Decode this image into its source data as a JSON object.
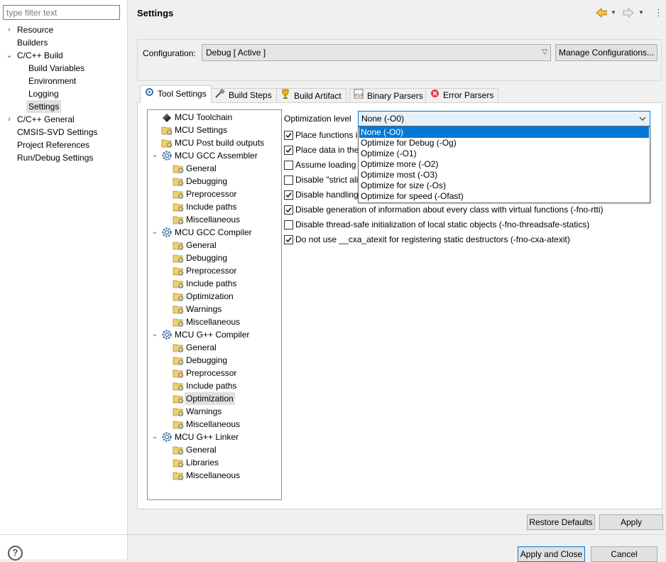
{
  "filter": {
    "placeholder": "type filter text"
  },
  "left_nav": [
    {
      "label": "Resource",
      "expandable": true
    },
    {
      "label": "Builders"
    },
    {
      "label": "C/C++ Build",
      "expanded": true
    },
    {
      "label": "Build Variables"
    },
    {
      "label": "Environment"
    },
    {
      "label": "Logging"
    },
    {
      "label": "Settings",
      "selected": true
    },
    {
      "label": "C/C++ General",
      "expandable": true
    },
    {
      "label": "CMSIS-SVD Settings"
    },
    {
      "label": "Project References"
    },
    {
      "label": "Run/Debug Settings"
    }
  ],
  "header": {
    "title": "Settings"
  },
  "config": {
    "label": "Configuration:",
    "value": "Debug  [ Active ]",
    "manage_label": "Manage Configurations..."
  },
  "tabs": [
    {
      "label": "Tool Settings",
      "icon": "tool-settings-icon",
      "active": true
    },
    {
      "label": "Build Steps",
      "icon": "build-steps-icon"
    },
    {
      "label": "Build Artifact",
      "icon": "build-artifact-icon"
    },
    {
      "label": "Binary Parsers",
      "icon": "binary-parsers-icon"
    },
    {
      "label": "Error Parsers",
      "icon": "error-parsers-icon"
    }
  ],
  "tree": [
    {
      "label": "MCU Toolchain",
      "level": 0,
      "icon": "toolchain-icon"
    },
    {
      "label": "MCU Settings",
      "level": 0,
      "icon": "folder-settings-icon"
    },
    {
      "label": "MCU Post build outputs",
      "level": 0,
      "icon": "folder-settings-icon"
    },
    {
      "label": "MCU GCC Assembler",
      "level": 0,
      "icon": "gear-icon",
      "expanded": true
    },
    {
      "label": "General",
      "level": 1,
      "icon": "folder-settings-icon"
    },
    {
      "label": "Debugging",
      "level": 1,
      "icon": "folder-settings-icon"
    },
    {
      "label": "Preprocessor",
      "level": 1,
      "icon": "folder-settings-icon"
    },
    {
      "label": "Include paths",
      "level": 1,
      "icon": "folder-settings-icon"
    },
    {
      "label": "Miscellaneous",
      "level": 1,
      "icon": "folder-settings-icon"
    },
    {
      "label": "MCU GCC Compiler",
      "level": 0,
      "icon": "gear-icon",
      "expanded": true
    },
    {
      "label": "General",
      "level": 1,
      "icon": "folder-settings-icon"
    },
    {
      "label": "Debugging",
      "level": 1,
      "icon": "folder-settings-icon"
    },
    {
      "label": "Preprocessor",
      "level": 1,
      "icon": "folder-settings-icon"
    },
    {
      "label": "Include paths",
      "level": 1,
      "icon": "folder-settings-icon"
    },
    {
      "label": "Optimization",
      "level": 1,
      "icon": "folder-settings-icon"
    },
    {
      "label": "Warnings",
      "level": 1,
      "icon": "folder-settings-icon"
    },
    {
      "label": "Miscellaneous",
      "level": 1,
      "icon": "folder-settings-icon"
    },
    {
      "label": "MCU G++ Compiler",
      "level": 0,
      "icon": "gear-icon",
      "expanded": true
    },
    {
      "label": "General",
      "level": 1,
      "icon": "folder-settings-icon"
    },
    {
      "label": "Debugging",
      "level": 1,
      "icon": "folder-settings-icon"
    },
    {
      "label": "Preprocessor",
      "level": 1,
      "icon": "folder-settings-icon"
    },
    {
      "label": "Include paths",
      "level": 1,
      "icon": "folder-settings-icon"
    },
    {
      "label": "Optimization",
      "level": 1,
      "icon": "folder-settings-icon",
      "selected": true
    },
    {
      "label": "Warnings",
      "level": 1,
      "icon": "folder-settings-icon"
    },
    {
      "label": "Miscellaneous",
      "level": 1,
      "icon": "folder-settings-icon"
    },
    {
      "label": "MCU G++ Linker",
      "level": 0,
      "icon": "gear-icon",
      "expanded": true
    },
    {
      "label": "General",
      "level": 1,
      "icon": "folder-settings-icon"
    },
    {
      "label": "Libraries",
      "level": 1,
      "icon": "folder-settings-icon"
    },
    {
      "label": "Miscellaneous",
      "level": 1,
      "icon": "folder-settings-icon"
    }
  ],
  "optimization": {
    "label": "Optimization level",
    "value": "None (-O0)",
    "options": [
      "None (-O0)",
      "Optimize for Debug (-Og)",
      "Optimize (-O1)",
      "Optimize more (-O2)",
      "Optimize most (-O3)",
      "Optimize for size (-Os)",
      "Optimize for speed (-Ofast)"
    ],
    "selected_index": 0
  },
  "checkboxes": [
    {
      "label": "Place functions i",
      "checked": true
    },
    {
      "label": "Place data in the",
      "checked": true
    },
    {
      "label": "Assume loading",
      "checked": false
    },
    {
      "label": "Disable \"strict ali",
      "checked": false
    },
    {
      "label": "Disable handling",
      "checked": true
    },
    {
      "label": "Disable generation of information about every class with virtual functions (-fno-rtti)",
      "checked": true
    },
    {
      "label": "Disable thread-safe initialization of local static objects (-fno-threadsafe-statics)",
      "checked": false
    },
    {
      "label": "Do not use __cxa_atexit for registering static destructors (-fno-cxa-atexit)",
      "checked": true
    }
  ],
  "buttons": {
    "restore_defaults": "Restore Defaults",
    "apply": "Apply",
    "apply_and_close": "Apply and Close",
    "cancel": "Cancel"
  },
  "colors": {
    "selection": "#0078d7",
    "combo_focus_bg": "#e5f1fb",
    "tree_selected_bg": "#e0e0e0"
  }
}
